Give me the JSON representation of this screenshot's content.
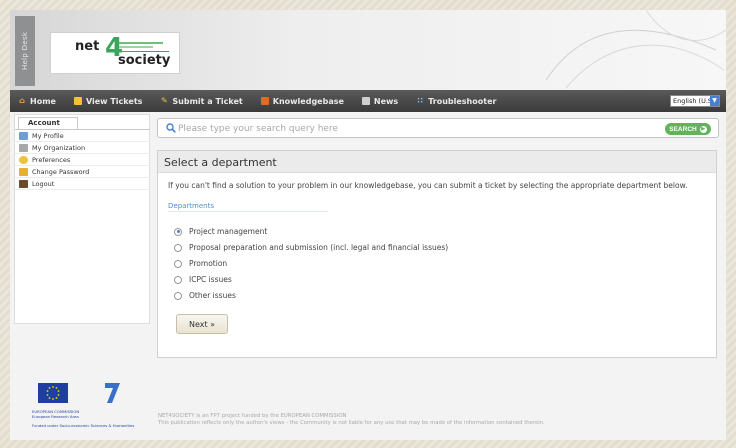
{
  "header": {
    "helpdesk_label": "Help Desk",
    "logo_net": "net",
    "logo_four": "4",
    "logo_society": "society"
  },
  "nav": {
    "items": [
      {
        "label": "Home",
        "icon": "home-icon",
        "color": "#f0a040"
      },
      {
        "label": "View Tickets",
        "icon": "tickets-icon",
        "color": "#f2c23a"
      },
      {
        "label": "Submit a Ticket",
        "icon": "pencil-icon",
        "color": "#f2c23a"
      },
      {
        "label": "Knowledgebase",
        "icon": "book-icon",
        "color": "#e06a2a"
      },
      {
        "label": "News",
        "icon": "news-icon",
        "color": "#cfcfcf"
      },
      {
        "label": "Troubleshooter",
        "icon": "troubleshooter-icon",
        "color": "#7ab3e6"
      }
    ],
    "language": "English (U.S.)"
  },
  "sidebar": {
    "tab_label": "Account",
    "items": [
      {
        "label": "My Profile",
        "icon": "profile-icon",
        "color": "#6d9fd6"
      },
      {
        "label": "My Organization",
        "icon": "organization-icon",
        "color": "#a8a8a8"
      },
      {
        "label": "Preferences",
        "icon": "preferences-icon",
        "color": "#f0c040"
      },
      {
        "label": "Change Password",
        "icon": "lock-icon",
        "color": "#e8b030"
      },
      {
        "label": "Logout",
        "icon": "logout-icon",
        "color": "#6b4a2a"
      }
    ]
  },
  "search": {
    "placeholder": "Please type your search query here",
    "button_label": "SEARCH"
  },
  "panel": {
    "title": "Select a department",
    "description": "If you can't find a solution to your problem in our knowledgebase, you can submit a ticket by selecting the appropriate department below.",
    "departments_label": "Departments",
    "options": [
      {
        "label": "Project management",
        "selected": true
      },
      {
        "label": "Proposal preparation and submission (incl. legal and financial issues)",
        "selected": false
      },
      {
        "label": "Promotion",
        "selected": false
      },
      {
        "label": "ICPC issues",
        "selected": false
      },
      {
        "label": "Other issues",
        "selected": false
      }
    ],
    "next_label": "Next »"
  },
  "footer": {
    "line1": "NET4SOCIETY is an FP7 project funded by the EUROPEAN COMMISSION",
    "line2": "This publication reflects only the author's views - the Community is not liable for any use that may be made of the information contained therein.",
    "eu_text_1": "EUROPEAN COMMISSION",
    "eu_text_2": "European Research Area",
    "eu_text_3": "Funded under Socio-economic Sciences & Humanities"
  }
}
